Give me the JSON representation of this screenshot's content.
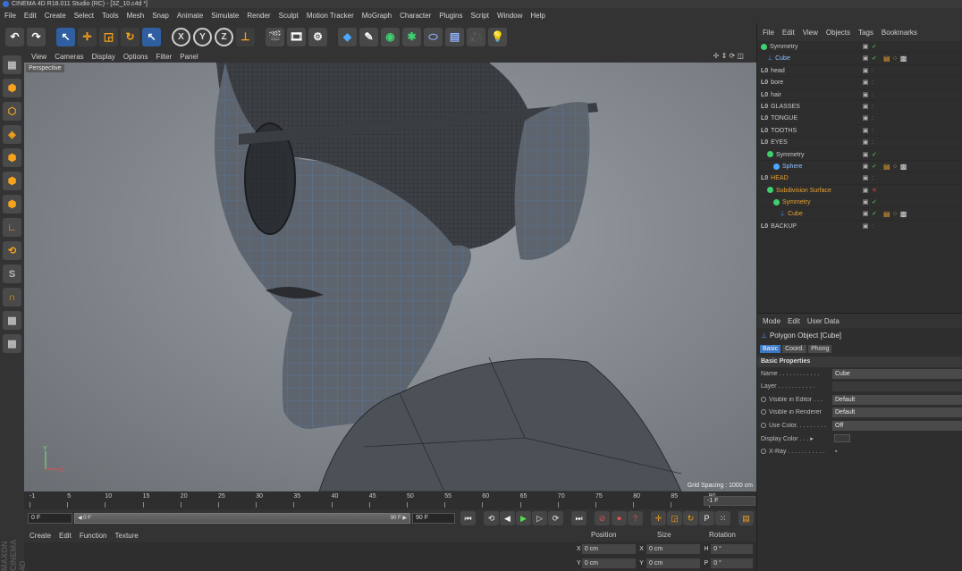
{
  "app": {
    "title": "CINEMA 4D R18.011 Studio (RC) - [3Z_10.c4d *]"
  },
  "menubar": [
    "File",
    "Edit",
    "Create",
    "Select",
    "Tools",
    "Mesh",
    "Snap",
    "Animate",
    "Simulate",
    "Render",
    "Sculpt",
    "Motion Tracker",
    "MoGraph",
    "Character",
    "Plugins",
    "Script",
    "Window",
    "Help"
  ],
  "viewport": {
    "menu": [
      "View",
      "Cameras",
      "Display",
      "Options",
      "Filter",
      "Panel"
    ],
    "label": "Perspective",
    "grid_spacing": "Grid Spacing : 1000 cm",
    "nav_icons": "✢ ⇕ ⟳ ◫"
  },
  "timeline": {
    "ticks": [
      "-1",
      "5",
      "10",
      "15",
      "20",
      "25",
      "30",
      "35",
      "40",
      "45",
      "50",
      "55",
      "60",
      "65",
      "70",
      "75",
      "80",
      "85",
      "90"
    ],
    "current": "-1 F"
  },
  "playbar": {
    "start": "0 F",
    "slider_left": "◀ 0 F",
    "slider_right": "90 F ▶",
    "end": "90 F"
  },
  "material_manager": {
    "menu": [
      "Create",
      "Edit",
      "Function",
      "Texture"
    ]
  },
  "coordinates": {
    "headers": [
      "Position",
      "Size",
      "Rotation"
    ],
    "rows": [
      {
        "axis": "X",
        "pos": "0 cm",
        "size_axis": "X",
        "size": "0 cm",
        "rot_axis": "H",
        "rot": "0 °"
      },
      {
        "axis": "Y",
        "pos": "0 cm",
        "size_axis": "Y",
        "size": "0 cm",
        "rot_axis": "P",
        "rot": "0 °"
      }
    ]
  },
  "side_brand": "MAXON CINEMA 4D",
  "object_manager": {
    "menu": [
      "File",
      "Edit",
      "View",
      "Objects",
      "Tags",
      "Bookmarks"
    ],
    "objects": [
      {
        "name": "Symmetry",
        "type": "sym",
        "indent": 0
      },
      {
        "name": "Cube",
        "type": "cube",
        "indent": 1
      },
      {
        "name": "head",
        "type": "null",
        "indent": 0
      },
      {
        "name": "bore",
        "type": "null",
        "indent": 0
      },
      {
        "name": "hair",
        "type": "null",
        "indent": 0
      },
      {
        "name": "GLASSES",
        "type": "null",
        "indent": 0
      },
      {
        "name": "TONGUE",
        "type": "null",
        "indent": 0
      },
      {
        "name": "TOOTHS",
        "type": "null",
        "indent": 0
      },
      {
        "name": "EYES",
        "type": "null",
        "indent": 0
      },
      {
        "name": "Symmetry",
        "type": "sym",
        "indent": 1
      },
      {
        "name": "Sphere",
        "type": "sphere",
        "indent": 2
      },
      {
        "name": "HEAD",
        "type": "null",
        "indent": 0,
        "highlight": true
      },
      {
        "name": "Subdivision Surface",
        "type": "sub",
        "indent": 1,
        "highlight": true
      },
      {
        "name": "Symmetry",
        "type": "sym",
        "indent": 2,
        "highlight": true
      },
      {
        "name": "Cube",
        "type": "cube",
        "indent": 3,
        "highlight": true
      },
      {
        "name": "BACKUP",
        "type": "null",
        "indent": 0
      }
    ]
  },
  "attributes": {
    "menu": [
      "Mode",
      "Edit",
      "User Data"
    ],
    "object_title": "Polygon Object [Cube]",
    "tabs": [
      "Basic",
      "Coord.",
      "Phong"
    ],
    "section": "Basic Properties",
    "fields": [
      {
        "label": "Name . . . . . . . . . . . .",
        "value": "Cube",
        "radio": false
      },
      {
        "label": "Layer . . . . . . . . . . .",
        "value": "",
        "radio": false
      },
      {
        "label": "Visible in Editor . . .",
        "value": "Default",
        "radio": true
      },
      {
        "label": "Visible in Renderer",
        "value": "Default",
        "radio": true
      },
      {
        "label": "Use Color. . . . . . . . .",
        "value": "Off",
        "radio": true
      },
      {
        "label": "Display Color . . . ▸",
        "value": "",
        "radio": false
      },
      {
        "label": "X-Ray . . . . . . . . . . .",
        "value": "▪",
        "radio": true
      }
    ]
  }
}
